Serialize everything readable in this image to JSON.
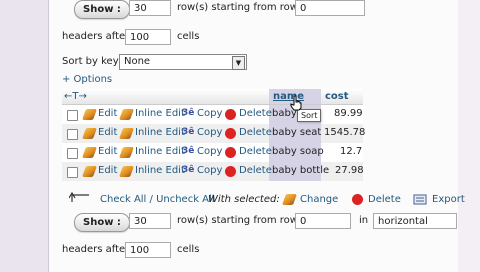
{
  "top_nav": {
    "show_label": "Show :",
    "rows_value": "30",
    "rows_text": "row(s) starting from row #",
    "start_value": "0",
    "headers_text": "headers after",
    "headers_value": "100",
    "cells_text": "cells"
  },
  "sort": {
    "label": "Sort by key:",
    "selected": "None"
  },
  "options_label": "+ Options",
  "table": {
    "columns": [
      "name",
      "cost"
    ],
    "tooltip": "Sort",
    "actions": {
      "edit": "Edit",
      "inline_edit": "Inline Edit",
      "copy": "Copy",
      "delete": "Delete"
    },
    "rows": [
      {
        "name": "baby",
        "cost": "89.99"
      },
      {
        "name": "baby seat",
        "cost": "1545.78"
      },
      {
        "name": "baby soap",
        "cost": "12.7"
      },
      {
        "name": "baby bottle",
        "cost": "27.98"
      }
    ]
  },
  "bulk": {
    "check_all": "Check All / Uncheck All",
    "with_selected": "With selected:",
    "change": "Change",
    "delete": "Delete",
    "export": "Export"
  },
  "bottom_nav": {
    "show_label": "Show :",
    "rows_value": "30",
    "rows_text": "row(s) starting from row #",
    "start_value": "0",
    "in_text": "in",
    "mode_value": "horizontal",
    "headers_text": "headers after",
    "headers_value": "100",
    "cells_text": "cells"
  }
}
